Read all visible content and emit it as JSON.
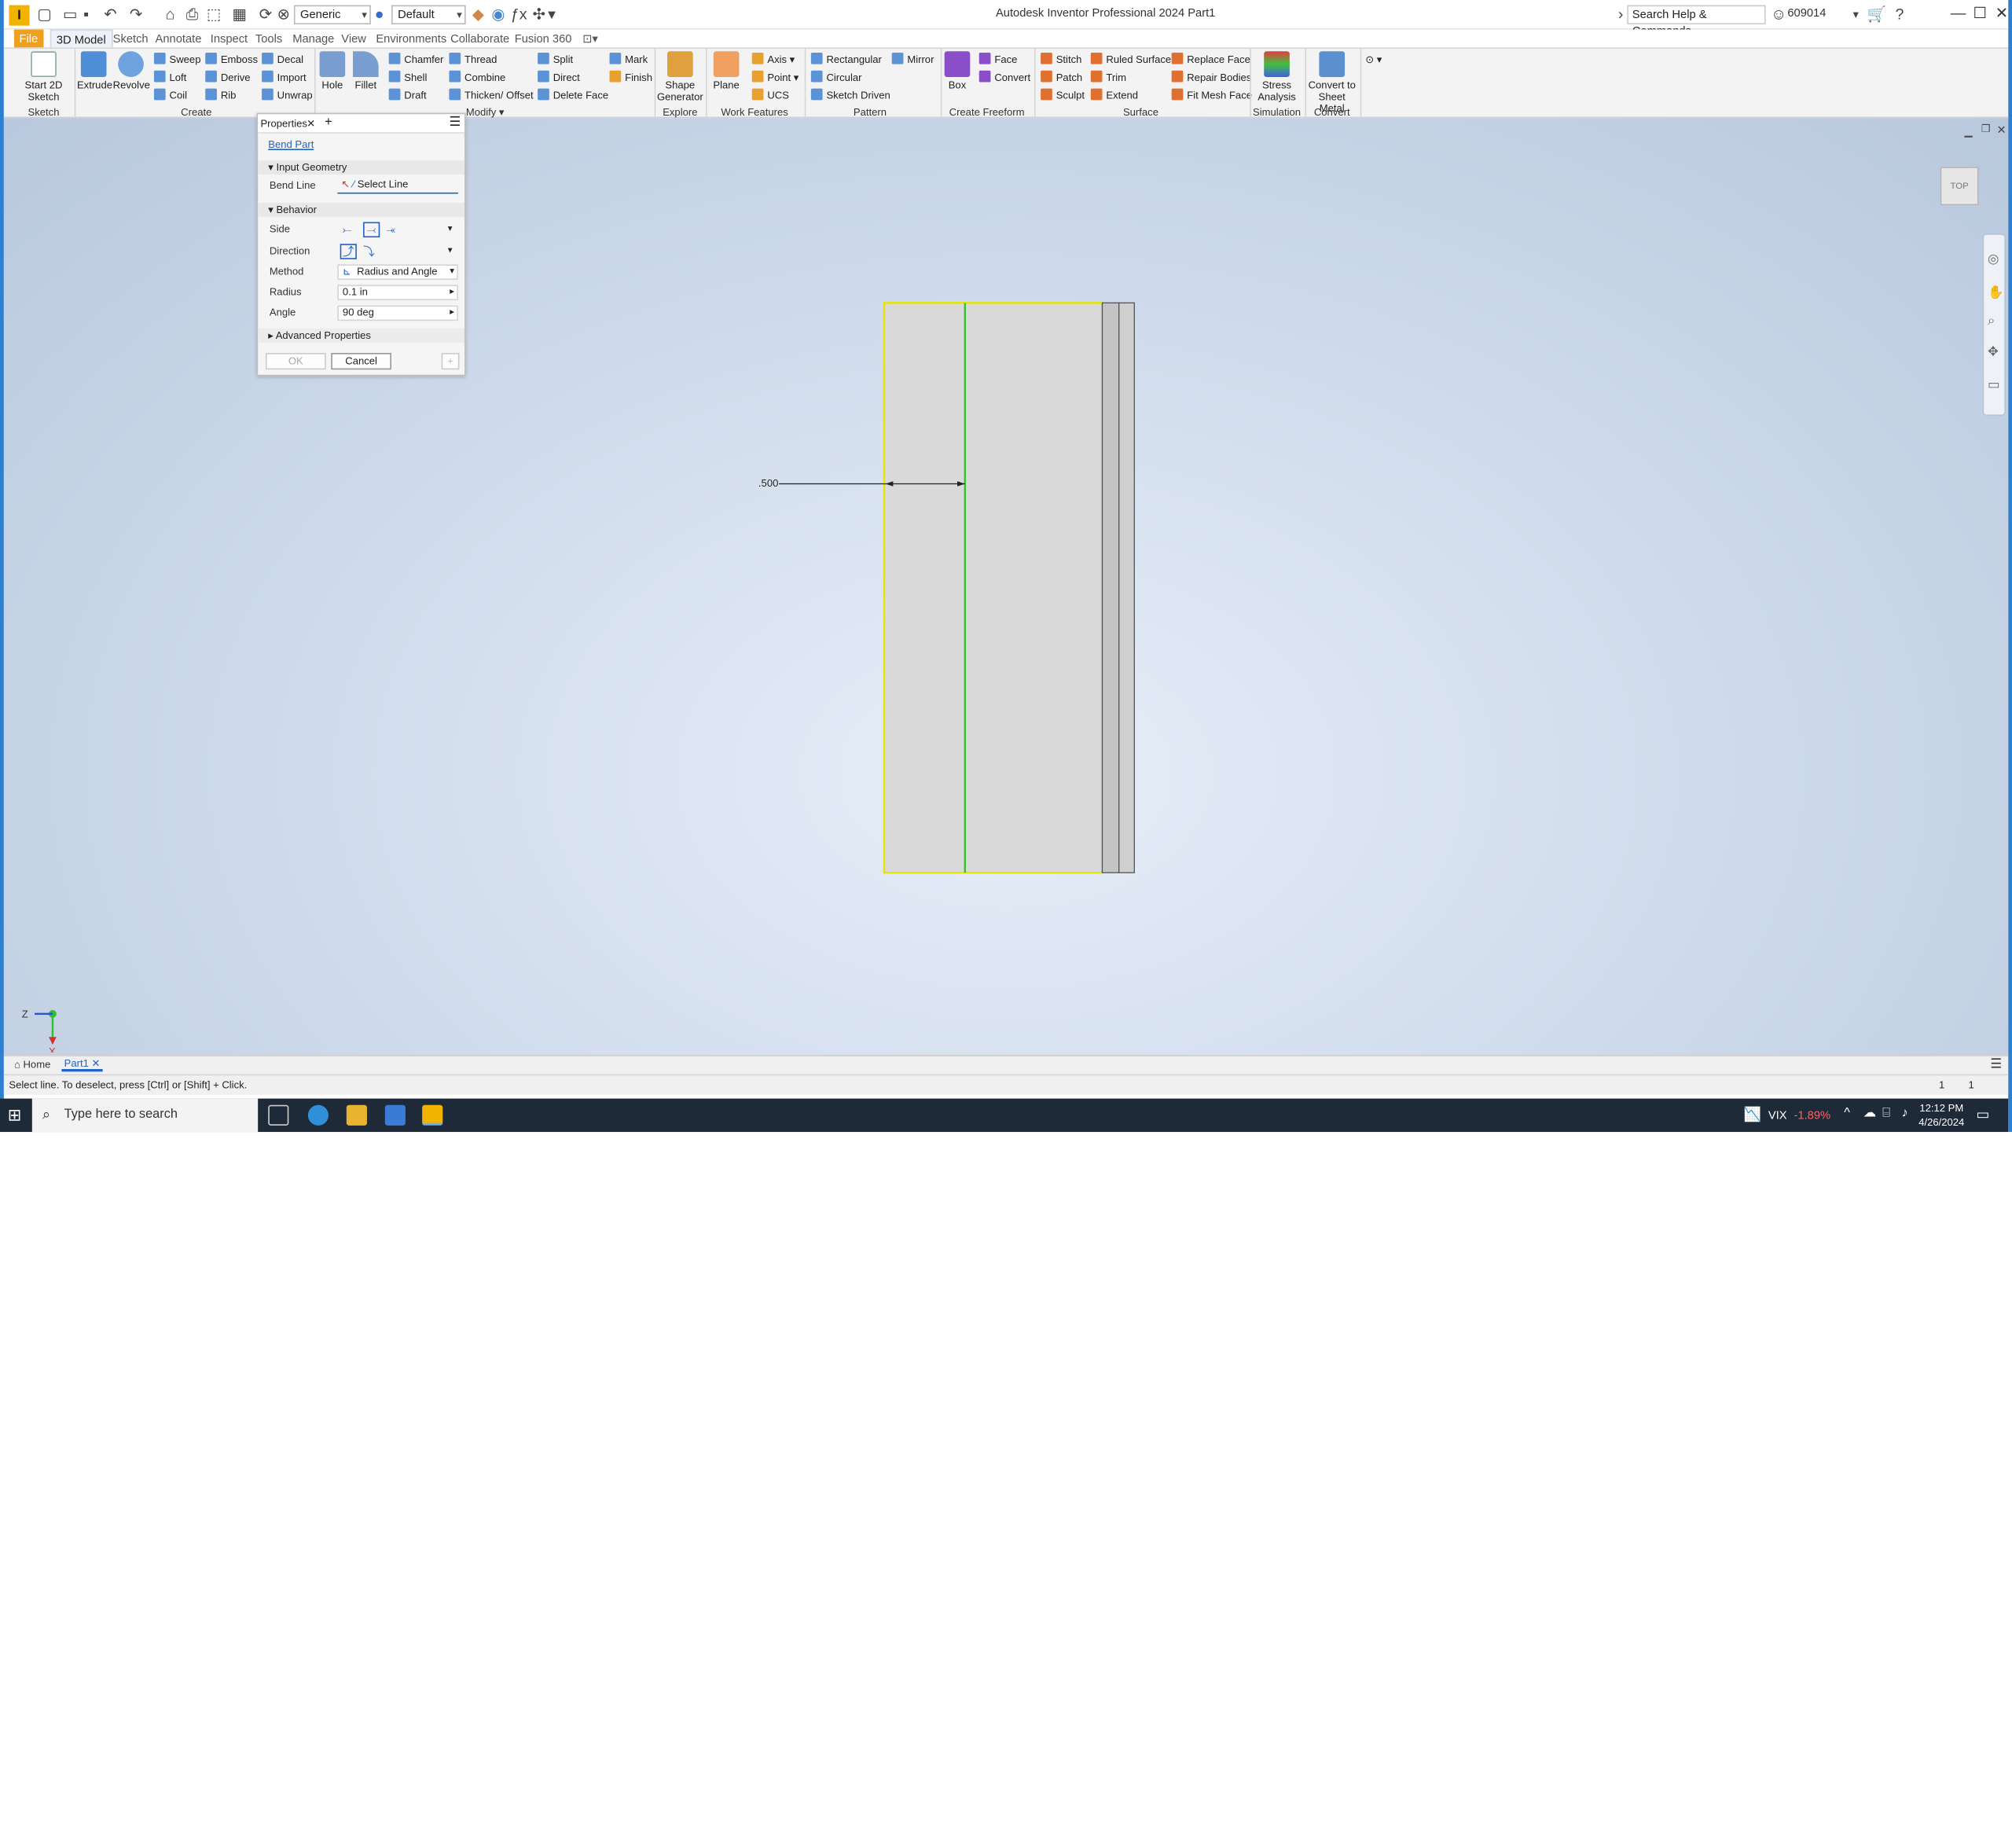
{
  "titlebar": {
    "app_logo": "I",
    "appearance_combo": "Generic",
    "material_combo": "Default",
    "title": "Autodesk Inventor Professional 2024   Part1",
    "search_placeholder": "Search Help & Commands...",
    "user": "609014"
  },
  "tabs": [
    "File",
    "3D Model",
    "Sketch",
    "Annotate",
    "Inspect",
    "Tools",
    "Manage",
    "View",
    "Environments",
    "Collaborate",
    "Fusion 360"
  ],
  "ribbon": {
    "sketch": {
      "start_sketch": "Start 2D Sketch",
      "label": "Sketch"
    },
    "create": {
      "extrude": "Extrude",
      "revolve": "Revolve",
      "sweep": "Sweep",
      "loft": "Loft",
      "coil": "Coil",
      "emboss": "Emboss",
      "derive": "Derive",
      "rib": "Rib",
      "decal": "Decal",
      "import": "Import",
      "unwrap": "Unwrap",
      "label": "Create"
    },
    "modify": {
      "hole": "Hole",
      "fillet": "Fillet",
      "chamfer": "Chamfer",
      "shell": "Shell",
      "draft": "Draft",
      "thread": "Thread",
      "combine": "Combine",
      "thicken": "Thicken/ Offset",
      "split": "Split",
      "direct": "Direct",
      "delete_face": "Delete Face",
      "mark": "Mark",
      "finish": "Finish",
      "label": "Modify"
    },
    "explore": {
      "shape_generator": "Shape Generator",
      "label": "Explore"
    },
    "work": {
      "plane": "Plane",
      "axis": "Axis",
      "point": "Point",
      "ucs": "UCS",
      "label": "Work Features"
    },
    "pattern": {
      "rectangular": "Rectangular",
      "circular": "Circular",
      "sketch_driven": "Sketch Driven",
      "mirror": "Mirror",
      "label": "Pattern"
    },
    "freeform": {
      "box": "Box",
      "face": "Face",
      "convert": "Convert",
      "label": "Create Freeform"
    },
    "surface": {
      "stitch": "Stitch",
      "patch": "Patch",
      "sculpt": "Sculpt",
      "ruled_surface": "Ruled Surface",
      "trim": "Trim",
      "extend": "Extend",
      "replace_face": "Replace Face",
      "repair_bodies": "Repair Bodies",
      "fit_mesh_face": "Fit Mesh Face",
      "label": "Surface"
    },
    "simulation": {
      "stress_analysis": "Stress Analysis",
      "label": "Simulation"
    },
    "convert": {
      "to_sheet_metal": "Convert to Sheet Metal",
      "label": "Convert"
    }
  },
  "properties": {
    "tab": "Properties",
    "link": "Bend Part",
    "section_input": "Input Geometry",
    "bend_line_label": "Bend Line",
    "bend_line_value": "Select Line",
    "section_behavior": "Behavior",
    "side_label": "Side",
    "direction_label": "Direction",
    "method_label": "Method",
    "method_value": "Radius and Angle",
    "radius_label": "Radius",
    "radius_value": "0.1 in",
    "angle_label": "Angle",
    "angle_value": "90 deg",
    "advanced": "Advanced Properties",
    "ok": "OK",
    "cancel": "Cancel"
  },
  "viewcube": "TOP",
  "dimension": ".500",
  "browser_tabs": {
    "home": "Home",
    "part": "Part1"
  },
  "status": {
    "text": "Select line. To deselect, press [Ctrl] or [Shift] + Click.",
    "count1": "1",
    "count2": "1"
  },
  "taskbar": {
    "search": "Type here to search",
    "vix": "VIX",
    "vix_change": "-1.89%",
    "time": "12:12 PM",
    "date": "4/26/2024"
  }
}
